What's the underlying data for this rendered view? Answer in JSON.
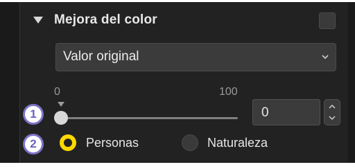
{
  "panel": {
    "title": "Mejora del color",
    "enabled": false
  },
  "dropdown": {
    "selected": "Valor original"
  },
  "slider": {
    "min_label": "0",
    "max_label": "100",
    "value": 0,
    "value_text": "0"
  },
  "mode": {
    "options": [
      {
        "label": "Personas",
        "selected": true
      },
      {
        "label": "Naturaleza",
        "selected": false
      }
    ]
  },
  "callouts": [
    "1",
    "2"
  ],
  "colors": {
    "panel_bg": "#222222",
    "selected_radio": "#ffd800",
    "callout_border": "#7b74c9"
  }
}
